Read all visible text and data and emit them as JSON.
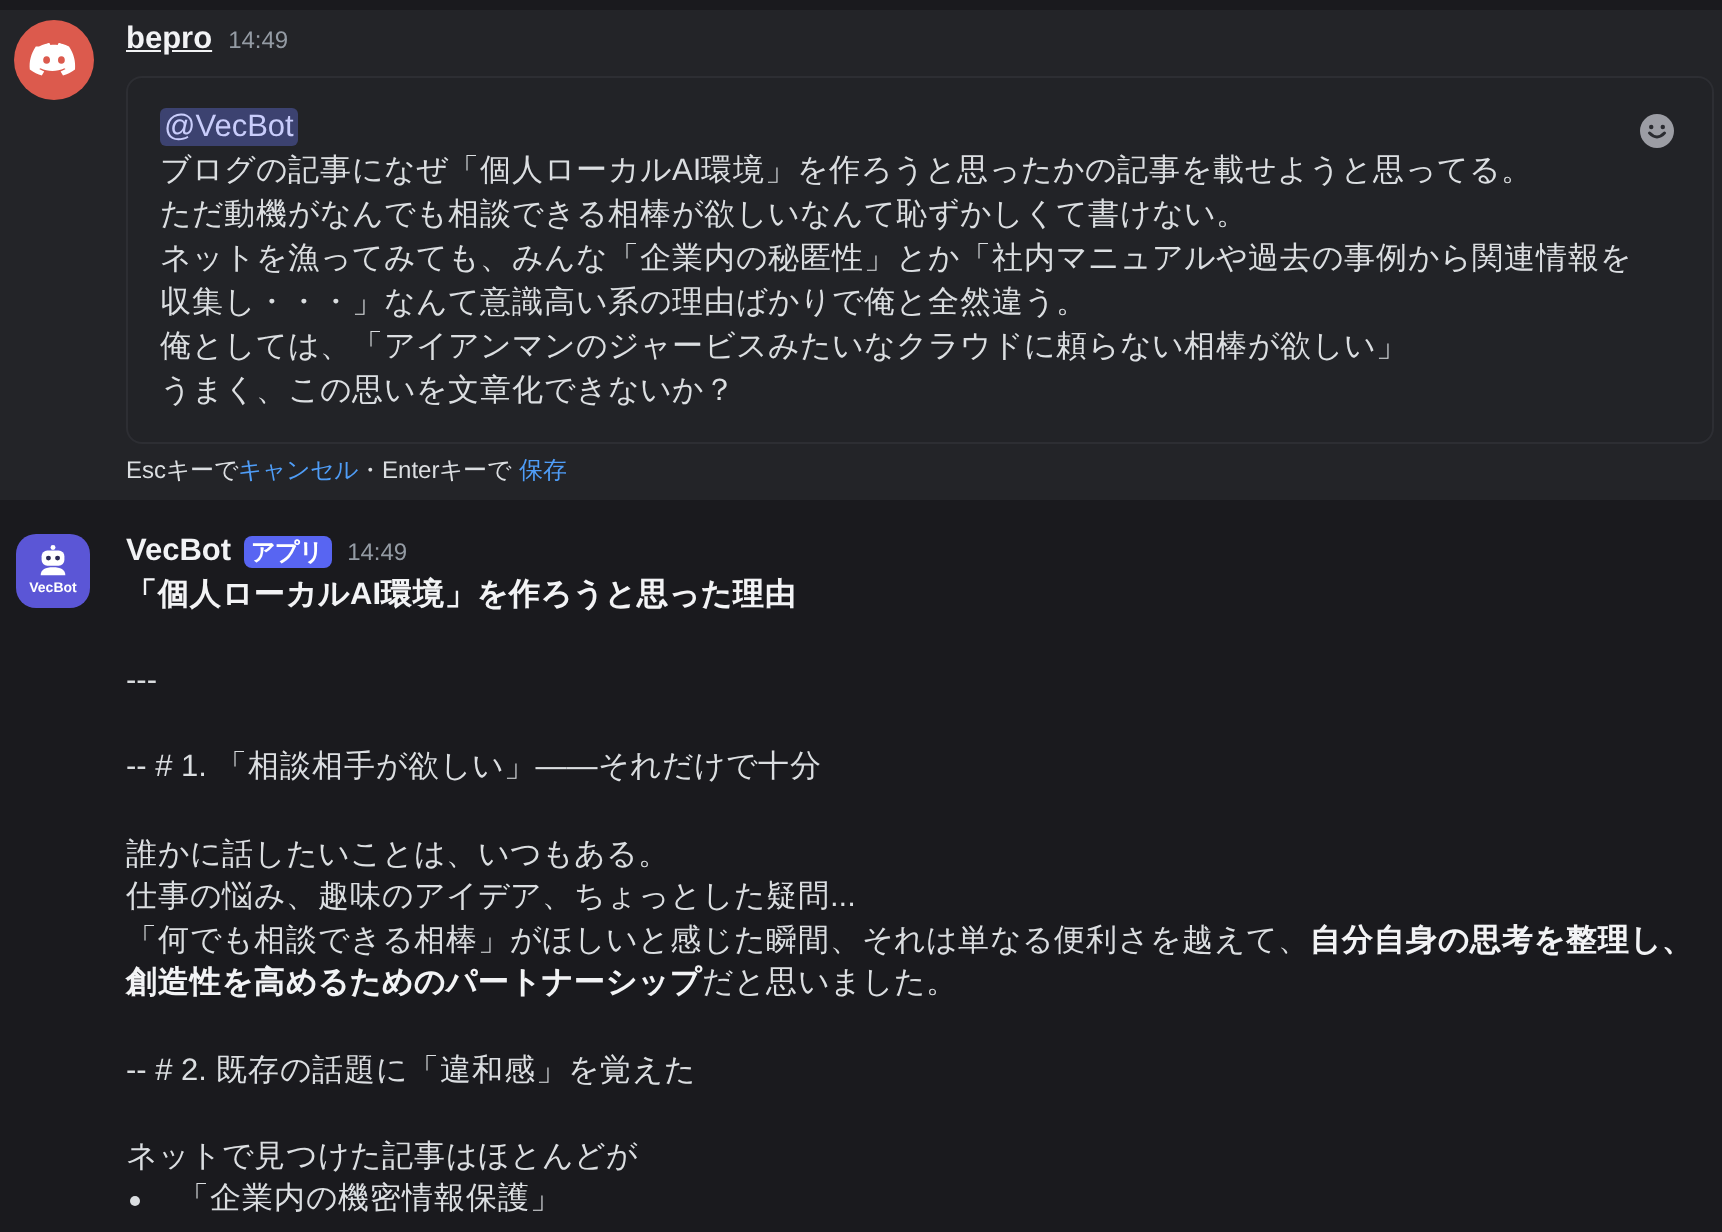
{
  "edited_message": {
    "author": "bepro",
    "time": "14:49",
    "mention": "@VecBot",
    "lines": [
      "ブログの記事になぜ「個人ローカルAI環境」を作ろうと思ったかの記事を載せようと思ってる。",
      "ただ動機がなんでも相談できる相棒が欲しいなんて恥ずかしくて書けない。",
      "ネットを漁ってみても、みんな「企業内の秘匿性」とか「社内マニュアルや過去の事例から関連情報を収集し・・・」なんて意識高い系の理由ばかりで俺と全然違う。",
      "俺としては、「アイアンマンのジャービスみたいなクラウドに頼らない相棒が欲しい」",
      "うまく、この思いを文章化できないか？"
    ],
    "hint": {
      "esc_text": "Escキーで",
      "cancel_link": "キャンセル",
      "enter_text": "・Enterキーで",
      "save_link": "保存"
    }
  },
  "bot_message": {
    "avatar_label": "VecBot",
    "author": "VecBot",
    "badge": "アプリ",
    "time": "14:49",
    "paragraphs": [
      [
        {
          "kind": "strong",
          "text": "「個人ローカルAI環境」を作ろうと思った理由"
        }
      ],
      [
        {
          "kind": "plain",
          "text": "---"
        }
      ],
      [
        {
          "kind": "plain",
          "text": "-- # 1. 「相談相手が欲しい」——それだけで十分"
        }
      ],
      [
        {
          "kind": "plain",
          "text": "誰かに話したいことは、いつもある。"
        },
        {
          "kind": "plain",
          "text": "仕事の悩み、趣味のアイデア、ちょっとした疑問..."
        },
        {
          "kind": "plain",
          "text": "「何でも相談できる相棒」がほしいと感じた瞬間、それは単なる便利さを越えて、**自分自身の思考を整理し、創造性を高めるためのパートナーシップ**だと思いました。"
        }
      ],
      [
        {
          "kind": "plain",
          "text": "-- # 2. 既存の話題に「違和感」を覚えた"
        }
      ],
      [
        {
          "kind": "plain",
          "text": "ネットで見つけた記事はほとんどが"
        },
        {
          "kind": "bullet",
          "text": "「企業内の機密情報保護」"
        }
      ]
    ]
  }
}
